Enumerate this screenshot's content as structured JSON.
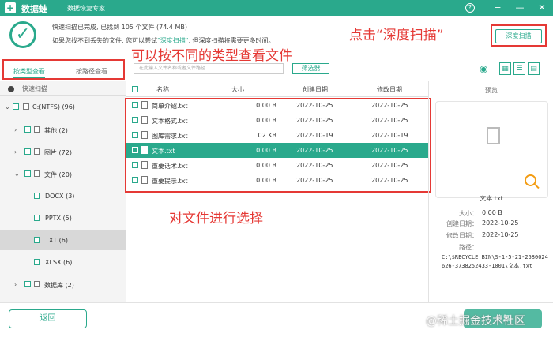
{
  "app": {
    "logo_text": "+",
    "title": "数据蛙",
    "subtitle": "数据恢复专家",
    "help": "?",
    "menu": "≡",
    "minimize": "—",
    "close": "✕"
  },
  "status": {
    "line1": "快速扫描已完成, 已找到 105 个文件 (74.4 MB)",
    "line2_prefix": "如果您找不到丢失的文件, 您可以尝试",
    "line2_link": "\"深度扫描\"",
    "line2_suffix": ", 但深度扫描将需要更多时间。",
    "deep_scan_button": "深度扫描"
  },
  "annotations": {
    "deep": "点击“深度扫描”",
    "type": "可以按不同的类型查看文件",
    "select": "对文件进行选择"
  },
  "tabs": {
    "type": "按类型查看",
    "path": "按路径查看"
  },
  "search": {
    "placeholder": "在此输入文件名称或者文件路径"
  },
  "filter": {
    "label": "筛选器"
  },
  "sidebar": {
    "quick_scan": "快速扫描",
    "items": [
      {
        "label": "C:(NTFS) (96)"
      },
      {
        "label": "其他 (2)"
      },
      {
        "label": "图片 (72)"
      },
      {
        "label": "文件 (20)"
      },
      {
        "label": "DOCX (3)"
      },
      {
        "label": "PPTX (5)"
      },
      {
        "label": "TXT (6)"
      },
      {
        "label": "XLSX (6)"
      },
      {
        "label": "数据库 (2)"
      }
    ]
  },
  "table": {
    "headers": {
      "name": "名称",
      "size": "大小",
      "created": "创建日期",
      "modified": "修改日期"
    },
    "rows": [
      {
        "name": "简单介绍.txt",
        "size": "0.00  B",
        "created": "2022-10-25",
        "modified": "2022-10-25"
      },
      {
        "name": "文本格式.txt",
        "size": "0.00  B",
        "created": "2022-10-25",
        "modified": "2022-10-25"
      },
      {
        "name": "图库需求.txt",
        "size": "1.02 KB",
        "created": "2022-10-19",
        "modified": "2022-10-19"
      },
      {
        "name": "文本.txt",
        "size": "0.00  B",
        "created": "2022-10-25",
        "modified": "2022-10-25"
      },
      {
        "name": "重要话术.txt",
        "size": "0.00  B",
        "created": "2022-10-25",
        "modified": "2022-10-25"
      },
      {
        "name": "重要提示.txt",
        "size": "0.00  B",
        "created": "2022-10-25",
        "modified": "2022-10-25"
      }
    ]
  },
  "preview": {
    "title": "预览",
    "file_name": "文本.txt",
    "size_label": "大小：",
    "size_value": "0.00  B",
    "created_label": "创建日期：",
    "created_value": "2022-10-25",
    "modified_label": "修改日期：",
    "modified_value": "2022-10-25",
    "path_label": "路径：",
    "path_value": "C:\\$RECYCLE.BIN\\S-1-5-21-2580024626-3738252433-1001\\文本.txt"
  },
  "bottom": {
    "back": "返回",
    "recover": "恢复",
    "watermark": "@稀土掘金技术社区"
  },
  "colors": {
    "brand": "#2aa98c",
    "annotation": "#e53935"
  }
}
